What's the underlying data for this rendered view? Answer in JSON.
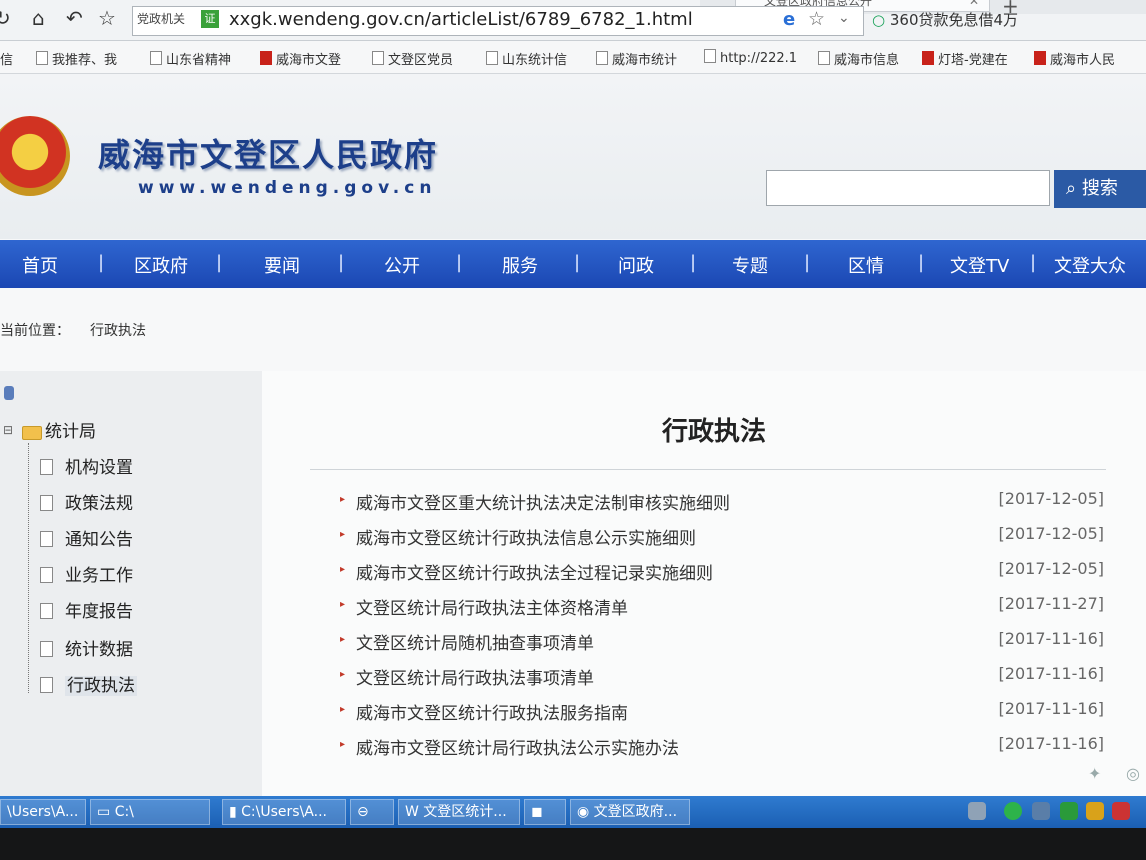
{
  "browser": {
    "tab_title": "文登区政府信息公开",
    "address_chip": "党政机关",
    "cert_label": "证",
    "url": "xxgk.wendeng.gov.cn/articleList/6789_6782_1.html",
    "ad_search": "360贷款免息借4万",
    "bookmarks": [
      "信",
      "我推荐、我",
      "山东省精神",
      "威海市文登",
      "文登区党员",
      "山东统计信",
      "威海市统计",
      "http://222.1",
      "威海市信息",
      "灯塔-党建在",
      "威海市人民"
    ]
  },
  "header": {
    "site_title": "威海市文登区人民政府",
    "site_url": "www.wendeng.gov.cn",
    "search_button": "搜索",
    "search_placeholder": ""
  },
  "nav": [
    "首页",
    "区政府",
    "要闻",
    "公开",
    "服务",
    "问政",
    "专题",
    "区情",
    "文登TV",
    "文登大众"
  ],
  "breadcrumb": {
    "label": "当前位置：",
    "current": "行政执法"
  },
  "sidebar": {
    "root": "统计局",
    "items": [
      "机构设置",
      "政策法规",
      "通知公告",
      "业务工作",
      "年度报告",
      "统计数据",
      "行政执法"
    ],
    "selected_index": 6
  },
  "content": {
    "title": "行政执法",
    "articles": [
      {
        "title": "威海市文登区重大统计执法决定法制审核实施细则",
        "date": "[2017-12-05]"
      },
      {
        "title": "威海市文登区统计行政执法信息公示实施细则",
        "date": "[2017-12-05]"
      },
      {
        "title": "威海市文登区统计行政执法全过程记录实施细则",
        "date": "[2017-12-05]"
      },
      {
        "title": "文登区统计局行政执法主体资格清单",
        "date": "[2017-11-27]"
      },
      {
        "title": "文登区统计局随机抽查事项清单",
        "date": "[2017-11-16]"
      },
      {
        "title": "文登区统计局行政执法事项清单",
        "date": "[2017-11-16]"
      },
      {
        "title": "威海市文登区统计行政执法服务指南",
        "date": "[2017-11-16]"
      },
      {
        "title": "威海市文登区统计局行政执法公示实施办法",
        "date": "[2017-11-16]"
      }
    ]
  },
  "taskbar": {
    "tasks": [
      "\\Users\\A...",
      "C:\\",
      "C:\\Users\\A...",
      "",
      "文登区统计...",
      "",
      "文登区政府..."
    ]
  }
}
